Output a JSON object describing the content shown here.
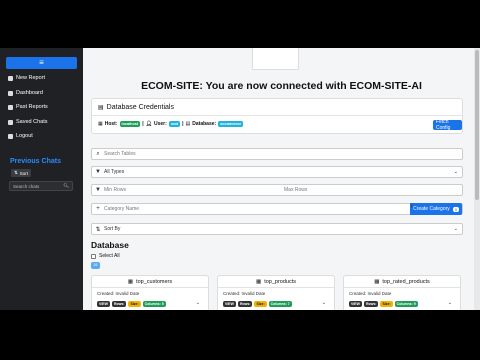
{
  "sidebar": {
    "menu_icon": "≡",
    "items": [
      {
        "label": "New Report",
        "icon": "report-icon"
      },
      {
        "label": "Dashboard",
        "icon": "dashboard-icon"
      },
      {
        "label": "Past Reports",
        "icon": "folder-icon"
      },
      {
        "label": "Saved Chats",
        "icon": "chat-icon"
      },
      {
        "label": "Logout",
        "icon": "logout-icon"
      }
    ],
    "previous_chats_title": "Previous Chats",
    "sort_label": "Sort",
    "search_placeholder": "Search chats"
  },
  "main": {
    "heading": "ECOM-SITE: You are now connected with ECOM-SITE-AI",
    "credentials": {
      "title": "Database Credentials",
      "host_label": "Host:",
      "host_value": "localhost",
      "user_label": "User:",
      "user_value": "root",
      "database_label": "Database:",
      "database_value": "ecommerce",
      "fetch_label": "Fetch Config"
    },
    "search_tables_placeholder": "Search Tables",
    "types_select": "All Types",
    "min_rows_placeholder": "Min Rows",
    "max_rows_placeholder": "Max Rows",
    "category_placeholder": "Category Name",
    "create_category_label": "Create Category",
    "create_category_count": "0",
    "sort_by": "Sort By",
    "database_title": "Database",
    "select_all_label": "Select All",
    "table_count": "26",
    "tables": [
      {
        "name": "top_customers",
        "created": "Created: Invalid Date",
        "view": "VIEW",
        "rows": "Rows:",
        "size": "Size:",
        "columns": "Columns: 5"
      },
      {
        "name": "top_products",
        "created": "Created: Invalid Date",
        "view": "VIEW",
        "rows": "Rows:",
        "size": "Size:",
        "columns": "Columns: 7"
      },
      {
        "name": "top_rated_products",
        "created": "Created: Invalid Date",
        "view": "VIEW",
        "rows": "Rows:",
        "size": "Size:",
        "columns": "Columns: 9"
      }
    ]
  },
  "colors": {
    "accent": "#1a73e8",
    "sidebar_bg": "#1f2124",
    "success": "#1e9e5a"
  }
}
